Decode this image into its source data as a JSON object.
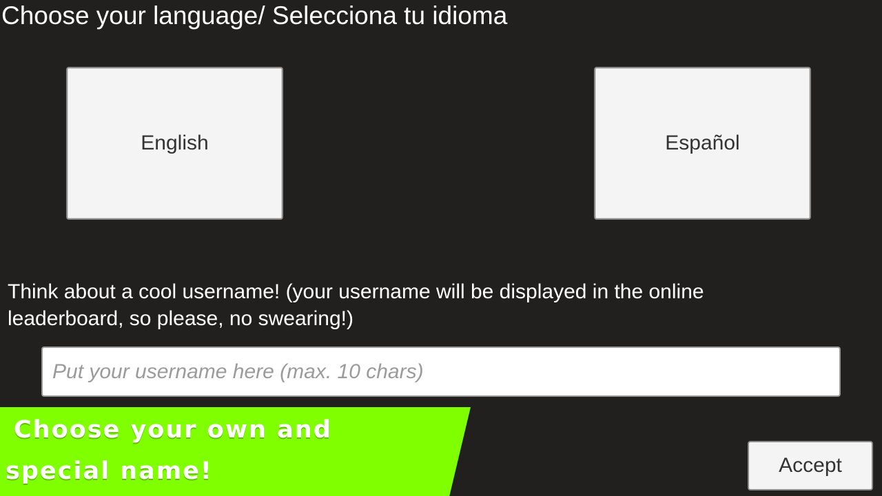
{
  "header": {
    "title": "Choose your language/ Selecciona tu idioma"
  },
  "languages": {
    "english_label": "English",
    "spanish_label": "Español"
  },
  "username": {
    "prompt": "Think about a cool username! (your username will be displayed in the online leaderboard, so please, no swearing!)",
    "placeholder": "Put your username here (max. 10 chars)",
    "value": ""
  },
  "promo": {
    "line1": "Choose your own and",
    "line2": "special name!",
    "color": "#7fff00"
  },
  "actions": {
    "accept_label": "Accept"
  }
}
